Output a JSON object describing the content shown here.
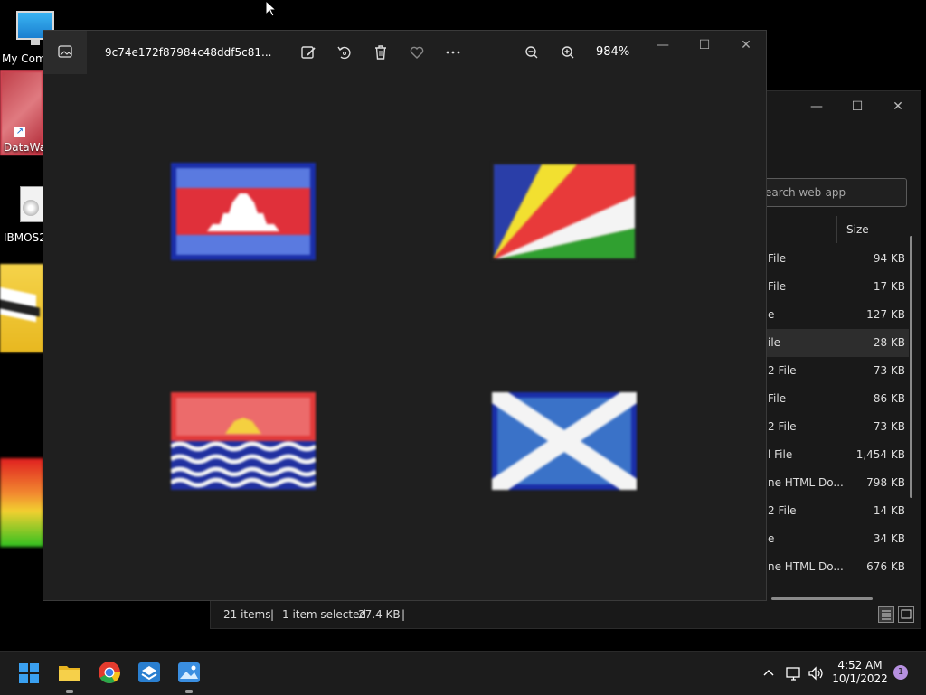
{
  "desktop": {
    "icons": [
      {
        "label": "My Com"
      },
      {
        "label": "DataWag"
      },
      {
        "label": "IBMOS2"
      }
    ]
  },
  "explorer": {
    "search_placeholder": "earch web-app",
    "column_size": "Size",
    "rows": [
      {
        "type": "File",
        "size": "94 KB"
      },
      {
        "type": "File",
        "size": "17 KB"
      },
      {
        "type": "e",
        "size": "127 KB"
      },
      {
        "type": "ile",
        "size": "28 KB",
        "selected": true
      },
      {
        "type": "2 File",
        "size": "73 KB"
      },
      {
        "type": "File",
        "size": "86 KB"
      },
      {
        "type": "2 File",
        "size": "73 KB"
      },
      {
        "type": "l File",
        "size": "1,454 KB"
      },
      {
        "type": "ne HTML Do...",
        "size": "798 KB"
      },
      {
        "type": "2 File",
        "size": "14 KB"
      },
      {
        "type": "e",
        "size": "34 KB"
      },
      {
        "type": "ne HTML Do...",
        "size": "676 KB"
      }
    ],
    "status": {
      "items": "21 items",
      "selected": "1 item selected",
      "size": "27.4 KB"
    }
  },
  "photos": {
    "title": "9c74e172f87984c48ddf5c81...",
    "zoom": "984%",
    "flags": [
      "cambodia-flag",
      "seychelles-flag",
      "kiribati-flag",
      "scotland-flag"
    ]
  },
  "taskbar": {
    "time": "4:52 AM",
    "date": "10/1/2022",
    "notifications": "1"
  },
  "colors": {
    "photos_bg": "#1f1f1f",
    "explorer_bg": "#191919",
    "taskbar_bg": "#1c1c1c",
    "accent": "#b690e0"
  }
}
